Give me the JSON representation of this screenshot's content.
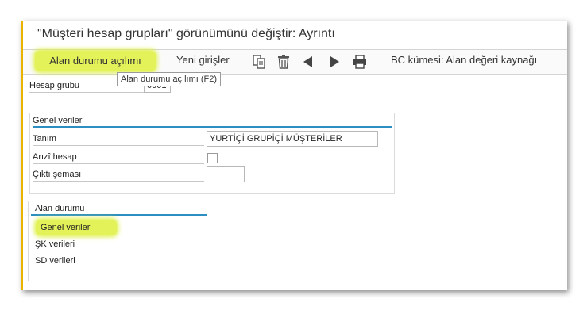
{
  "window": {
    "title": "\"Müşteri hesap grupları\" görünümünü değiştir: Ayrıntı"
  },
  "toolbar": {
    "field_status_label": "Alan durumu açılımı",
    "new_entries_label": "Yeni girişler",
    "bc_set_label": "BC kümesi: Alan değeri kaynağı",
    "icons": [
      "copy-icon",
      "delete-icon",
      "previous-icon",
      "next-icon",
      "print-icon"
    ]
  },
  "tooltip": {
    "text": "Alan durumu açılımı    (F2)"
  },
  "account_group": {
    "label": "Hesap grubu",
    "value": "0001"
  },
  "general_data": {
    "heading": "Genel veriler",
    "description_label": "Tanım",
    "description_value": "YURTİÇİ GRUPİÇİ MÜŞTERİLER",
    "one_time_label": "Arızî hesap",
    "one_time_checked": false,
    "output_schema_label": "Çıktı şeması",
    "output_schema_value": ""
  },
  "field_status": {
    "heading": "Alan durumu",
    "items": [
      "Genel veriler",
      "ŞK verileri",
      "SD verileri"
    ]
  },
  "colors": {
    "highlight": "#e4f25a",
    "group_line": "#2d8fc1",
    "frame_accent": "#e8b400"
  }
}
